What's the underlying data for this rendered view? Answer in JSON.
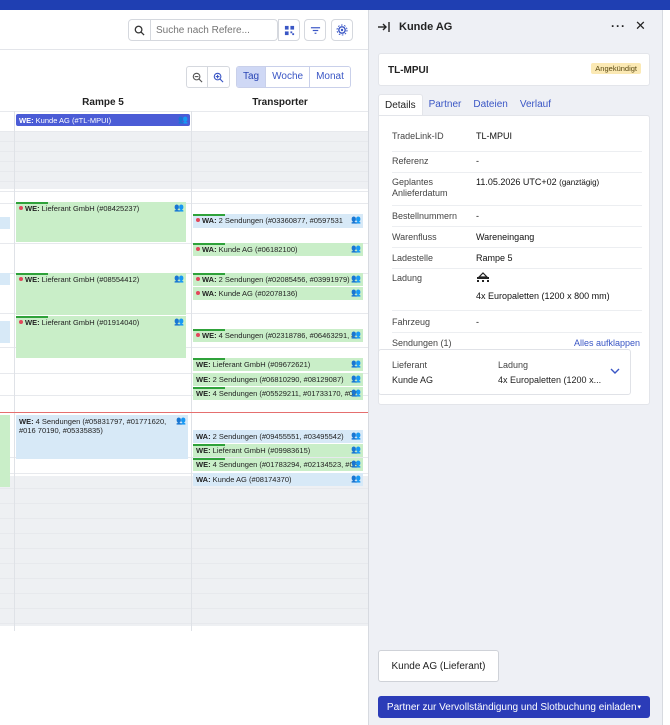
{
  "toolbar": {
    "search_placeholder": "Suche nach Refere...",
    "view_day": "Tag",
    "view_week": "Woche",
    "view_month": "Monat"
  },
  "columns": {
    "col1": "Rampe 5",
    "col2": "Transporter"
  },
  "events": {
    "e1": "WE: Kunde AG (#TL-MPUI)",
    "e2": "WE: Lieferant GmbH (#08425237)",
    "e3": "WA: 2 Sendungen (#03360877, #0597531",
    "e4": "WA: Kunde AG (#06182100)",
    "e5": "WE: Lieferant GmbH (#08554412)",
    "e6": "WA: 2 Sendungen (#02085456, #03991979)",
    "e7": "WA: Kunde AG (#02078136)",
    "e8": "WE: Lieferant GmbH (#01914040)",
    "e9": "WE: 4 Sendungen (#02318786, #06463291, #",
    "e10": "WE: Lieferant GmbH (#09672621)",
    "e11": "WE: 2 Sendungen (#06810290, #08129087)",
    "e12": "WE: 4 Sendungen (#05529211, #01733170, #07",
    "e13": "WE: 4 Sendungen (#05831797, #01771620, #016 70190, #05335835)",
    "e14": "WA: 2 Sendungen (#09455551, #03495542)",
    "e15": "WE: Lieferant GmbH (#09983615)",
    "e16": "WE: 4 Sendungen (#01783294, #02134523, #08",
    "e17": "WA: Kunde AG (#08174370)"
  },
  "panel": {
    "title": "Kunde AG",
    "ref_id": "TL-MPUI",
    "status": "Angekündigt",
    "tabs": [
      "Details",
      "Partner",
      "Dateien",
      "Verlauf"
    ],
    "details": {
      "tradelink_label": "TradeLink-ID",
      "tradelink_value": "TL-MPUI",
      "referenz_label": "Referenz",
      "referenz_value": "-",
      "datum_label": "Geplantes Anlieferdatum",
      "datum_value": "11.05.2026 UTC+02",
      "datum_suffix": "(ganztägig)",
      "bestell_label": "Bestellnummern",
      "bestell_value": "-",
      "fluss_label": "Warenfluss",
      "fluss_value": "Wareneingang",
      "lade_label": "Ladestelle",
      "lade_value": "Rampe 5",
      "ladung_label": "Ladung",
      "ladung_value": "4x Europaletten (1200 x 800 mm)",
      "fahrzeug_label": "Fahrzeug",
      "fahrzeug_value": "-"
    },
    "sendungen_label": "Sendungen (1)",
    "expand_all": "Alles aufklappen",
    "shipment": {
      "lieferant_label": "Lieferant",
      "lieferant_value": "Kunde AG",
      "ladung_label": "Ladung",
      "ladung_value": "4x Europaletten (1200 x..."
    },
    "partner_button": "Kunde AG (Lieferant)",
    "invite_button": "Partner zur Vervollständigung und Slotbuchung einladen"
  }
}
